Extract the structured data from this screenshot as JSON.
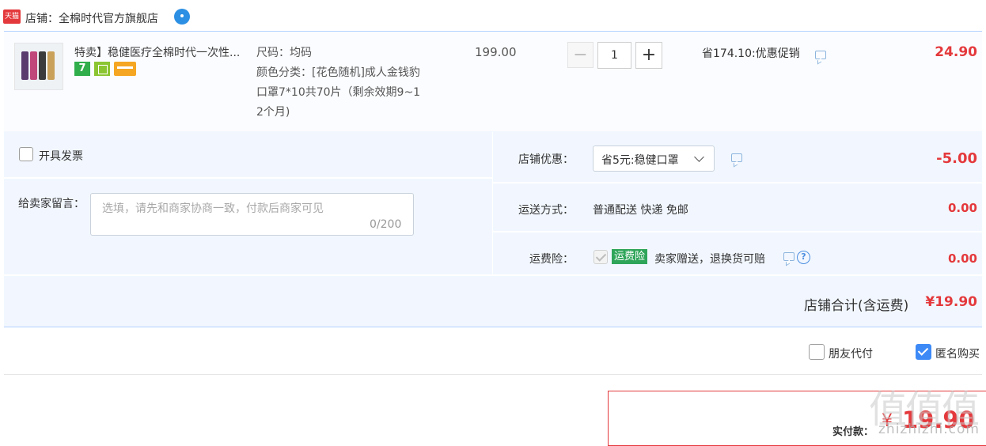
{
  "header": {
    "platform_badge": "天猫",
    "store_name": "店铺：全棉时代官方旗舰店"
  },
  "item": {
    "title": "特卖】稳健医疗全棉时代一次性...",
    "badge_7": "7",
    "spec_size": "尺码：均码",
    "spec_color_lines": [
      "颜色分类：[花色随机]成人金钱豹",
      "口罩7*10共70片（剩余效期9~1",
      "2个月)"
    ],
    "price": "199.00",
    "qty_minus": "−",
    "quantity": "1",
    "qty_plus": "+",
    "promotion": "省174.10:优惠促销",
    "subtotal": "24.90"
  },
  "options": {
    "invoice_label": "开具发票",
    "message_label": "给卖家留言：",
    "message_placeholder": "选填，请先和商家协商一致，付款后商家可见",
    "message_counter": "0/200",
    "store_discount_label": "店铺优惠：",
    "store_discount_selected": "省5元:稳健口罩",
    "store_discount_amount": "-5.00",
    "shipping_label": "运送方式：",
    "shipping_value": "普通配送 快递 免邮",
    "shipping_amount": "0.00",
    "insurance_label": "运费险：",
    "insurance_tag": "运费险",
    "insurance_text": "卖家赠送，退换货可赔",
    "insurance_amount": "0.00",
    "help_icon": "?",
    "total_label": "店铺合计(含运费)",
    "total_value": "¥19.90"
  },
  "footer": {
    "friend_pay_label": "朋友代付",
    "anonymous_label": "匿名购买",
    "pay_label": "实付款：",
    "pay_currency": "¥",
    "pay_value": "19.90",
    "watermark": "值值值",
    "watermark_url": "zhizhizhi.com"
  },
  "colors": {
    "accent_red": "#e4393c",
    "accent_blue": "#3d8af7",
    "panel_bg": "#f2f7ff",
    "insurance_green": "#2fa55a"
  },
  "icons": [
    "tmall-logo-icon",
    "chat-bubble-icon",
    "message-icon",
    "chevron-down-icon",
    "help-icon",
    "checkbox-icon"
  ]
}
